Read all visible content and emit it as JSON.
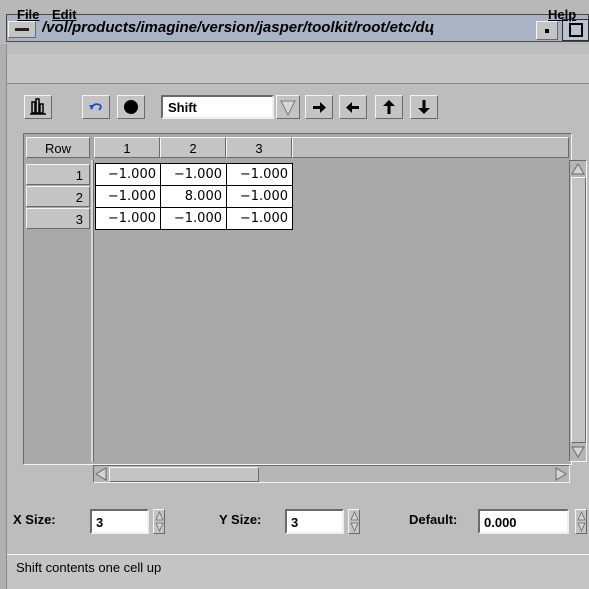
{
  "window": {
    "title": "/vol/products/imagine/version/jasper/toolkit/root/etc/dц"
  },
  "menubar": {
    "file": "File",
    "edit": "Edit",
    "help": "Help"
  },
  "toolbar": {
    "operation_value": "Shift"
  },
  "grid": {
    "row_header_label": "Row",
    "columns": [
      "1",
      "2",
      "3"
    ],
    "rows": [
      {
        "label": "1",
        "cells": [
          "−1.000",
          "−1.000",
          "−1.000"
        ]
      },
      {
        "label": "2",
        "cells": [
          "−1.000",
          "8.000",
          "−1.000"
        ]
      },
      {
        "label": "3",
        "cells": [
          "−1.000",
          "−1.000",
          "−1.000"
        ]
      }
    ]
  },
  "fields": {
    "x_size_label": "X Size:",
    "x_size_value": "3",
    "y_size_label": "Y Size:",
    "y_size_value": "3",
    "default_label": "Default:",
    "default_value": "0.000"
  },
  "status": {
    "text": "Shift contents one cell up"
  },
  "icons": {
    "toolbar_chart": "column-chart-icon",
    "toolbar_undo": "undo-icon",
    "toolbar_record": "record-dot-icon",
    "shift_right": "arrow-right-icon",
    "shift_left": "arrow-left-icon",
    "shift_up": "arrow-up-icon",
    "shift_down": "arrow-down-icon"
  },
  "colors": {
    "undo_accent": "#1c4fd0",
    "title_bar": "#aab3c4"
  }
}
